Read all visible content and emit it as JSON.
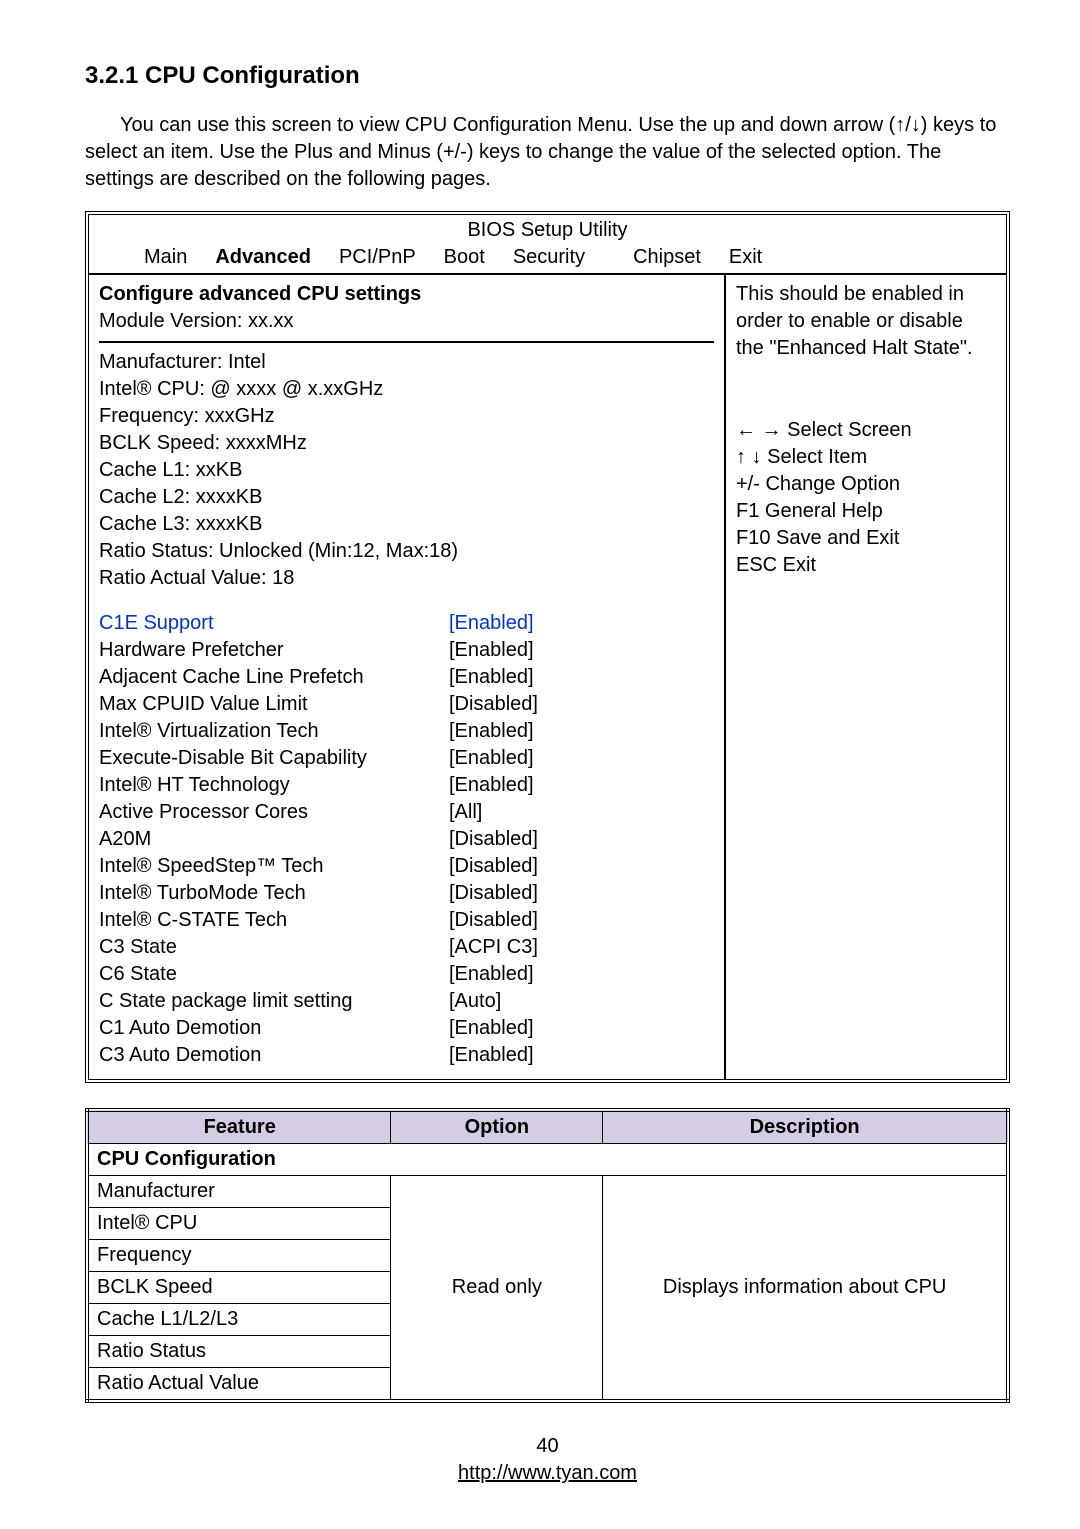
{
  "heading": "3.2.1 CPU Configuration",
  "intro": "You can use this screen to view CPU Configuration Menu. Use the up and down arrow (↑/↓) keys to select an item. Use the Plus and Minus (+/-) keys to change the value of the selected option. The settings are described on the following pages.",
  "bios": {
    "title": "BIOS Setup Utility",
    "menu": [
      "Main",
      "Advanced",
      "PCI/PnP",
      "Boot",
      "Security",
      "Chipset",
      "Exit"
    ],
    "config_title": "Configure advanced CPU settings",
    "module_version": "Module Version: xx.xx",
    "sysinfo": [
      "Manufacturer: Intel",
      "Intel® CPU:  @ xxxx @ x.xxGHz",
      "Frequency: xxxGHz",
      "BCLK Speed: xxxxMHz",
      "Cache L1: xxKB",
      "Cache L2: xxxxKB",
      "Cache L3: xxxxKB",
      "Ratio Status: Unlocked (Min:12, Max:18)",
      "Ratio Actual Value: 18"
    ],
    "selected": {
      "label": "C1E Support",
      "value": "[Enabled]"
    },
    "settings": [
      {
        "label": "Hardware Prefetcher",
        "value": "[Enabled]"
      },
      {
        "label": "Adjacent Cache Line Prefetch",
        "value": "[Enabled]"
      },
      {
        "label": "Max CPUID Value Limit",
        "value": "[Disabled]"
      },
      {
        "label": "Intel® Virtualization Tech",
        "value": "[Enabled]"
      },
      {
        "label": "Execute-Disable Bit Capability",
        "value": "[Enabled]"
      },
      {
        "label": "Intel® HT Technology",
        "value": "[Enabled]"
      },
      {
        "label": "Active Processor Cores",
        "value": "[All]"
      },
      {
        "label": "A20M",
        "value": "[Disabled]"
      },
      {
        "label": "Intel® SpeedStep™ Tech",
        "value": "[Disabled]"
      },
      {
        "label": "Intel® TurboMode Tech",
        "value": "[Disabled]"
      },
      {
        "label": "Intel® C-STATE Tech",
        "value": "[Disabled]"
      },
      {
        "label": "C3 State",
        "value": "[ACPI C3]"
      },
      {
        "label": "C6 State",
        "value": "[Enabled]"
      },
      {
        "label": "C State package limit setting",
        "value": "[Auto]"
      },
      {
        "label": "C1 Auto Demotion",
        "value": "[Enabled]"
      },
      {
        "label": "C3 Auto Demotion",
        "value": "[Enabled]"
      }
    ],
    "help1": "This should be enabled in order to enable or disable the \"Enhanced Halt State\".",
    "nav": [
      "← → Select Screen",
      "↑  ↓  Select Item",
      "+/-     Change Option",
      "F1     General Help",
      "F10   Save and Exit",
      "ESC  Exit"
    ]
  },
  "table": {
    "headers": [
      "Feature",
      "Option",
      "Description"
    ],
    "subhead": "CPU Configuration",
    "rows": [
      "Manufacturer",
      "Intel® CPU",
      "Frequency",
      "BCLK Speed",
      "Cache L1/L2/L3",
      "Ratio Status",
      "Ratio Actual Value"
    ],
    "option": "Read only",
    "desc": "Displays information about CPU"
  },
  "footer": {
    "page": "40",
    "url": "http://www.tyan.com"
  }
}
